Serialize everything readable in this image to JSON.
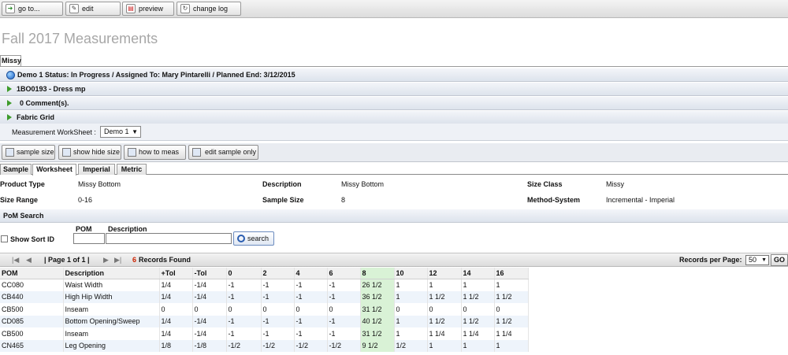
{
  "toolbar": {
    "buttons": [
      {
        "label": "go to...",
        "icon": "arrow-icon"
      },
      {
        "label": "edit",
        "icon": "edit-icon"
      },
      {
        "label": "preview",
        "icon": "pdf-icon"
      },
      {
        "label": "change log",
        "icon": "log-icon"
      }
    ]
  },
  "page_title": "Fall 2017 Measurements",
  "size_tab": "Missy",
  "sections": {
    "demo": "Demo 1  Status: In Progress / Assigned To: Mary Pintarelli / Planned End: 3/12/2015",
    "style": "1BO0193 - Dress mp",
    "comments": "0 Comment(s).",
    "fabric": "Fabric Grid"
  },
  "worksheet": {
    "label": "Measurement WorkSheet  :",
    "selected": "Demo 1"
  },
  "actions": [
    "sample size",
    "show hide size",
    "how to meas",
    "edit sample only"
  ],
  "tabs": [
    "Sample",
    "Worksheet",
    "Imperial",
    "Metric"
  ],
  "info": {
    "product_type_label": "Product Type",
    "product_type": "Missy Bottom",
    "description_label": "Description",
    "description": "Missy Bottom",
    "size_class_label": "Size Class",
    "size_class": "Missy",
    "size_range_label": "Size Range",
    "size_range": "0-16",
    "sample_size_label": "Sample Size",
    "sample_size": "8",
    "method_label": "Method-System",
    "method": "Incremental - Imperial"
  },
  "pom_search": {
    "title": "PoM Search",
    "pom_label": "POM",
    "description_label": "Description",
    "show_sort_label": "Show Sort ID",
    "search_button": "search"
  },
  "pager": {
    "page_label": "| Page 1 of 1 |",
    "records_count": "6",
    "records_text": "Records Found",
    "records_per_page_label": "Records per Page:",
    "records_per_page": "50",
    "go_label": "GO"
  },
  "grid": {
    "headers": [
      "POM",
      "Description",
      "+Tol",
      "-Tol",
      "0",
      "2",
      "4",
      "6",
      "8",
      "10",
      "12",
      "14",
      "16"
    ],
    "rows": [
      [
        "CC080",
        "Waist Width",
        "1/4",
        "-1/4",
        "-1",
        "-1",
        "-1",
        "-1",
        "26 1/2",
        "1",
        "1",
        "1",
        "1"
      ],
      [
        "CB440",
        "High Hip Width",
        "1/4",
        "-1/4",
        "-1",
        "-1",
        "-1",
        "-1",
        "36 1/2",
        "1",
        "1 1/2",
        "1 1/2",
        "1 1/2"
      ],
      [
        "CB500",
        "Inseam",
        "0",
        "0",
        "0",
        "0",
        "0",
        "0",
        "31 1/2",
        "0",
        "0",
        "0",
        "0"
      ],
      [
        "CD085",
        "Bottom Opening/Sweep",
        "1/4",
        "-1/4",
        "-1",
        "-1",
        "-1",
        "-1",
        "40 1/2",
        "1",
        "1 1/2",
        "1 1/2",
        "1 1/2"
      ],
      [
        "CB500",
        "Inseam",
        "1/4",
        "-1/4",
        "-1",
        "-1",
        "-1",
        "-1",
        "31 1/2",
        "1",
        "1 1/4",
        "1 1/4",
        "1 1/4"
      ],
      [
        "CN465",
        "Leg Opening",
        "1/8",
        "-1/8",
        "-1/2",
        "-1/2",
        "-1/2",
        "-1/2",
        "9 1/2",
        "1/2",
        "1",
        "1",
        "1"
      ]
    ]
  },
  "colors": {
    "accent": "#d9f2d6",
    "records_count": "#cc2200"
  }
}
